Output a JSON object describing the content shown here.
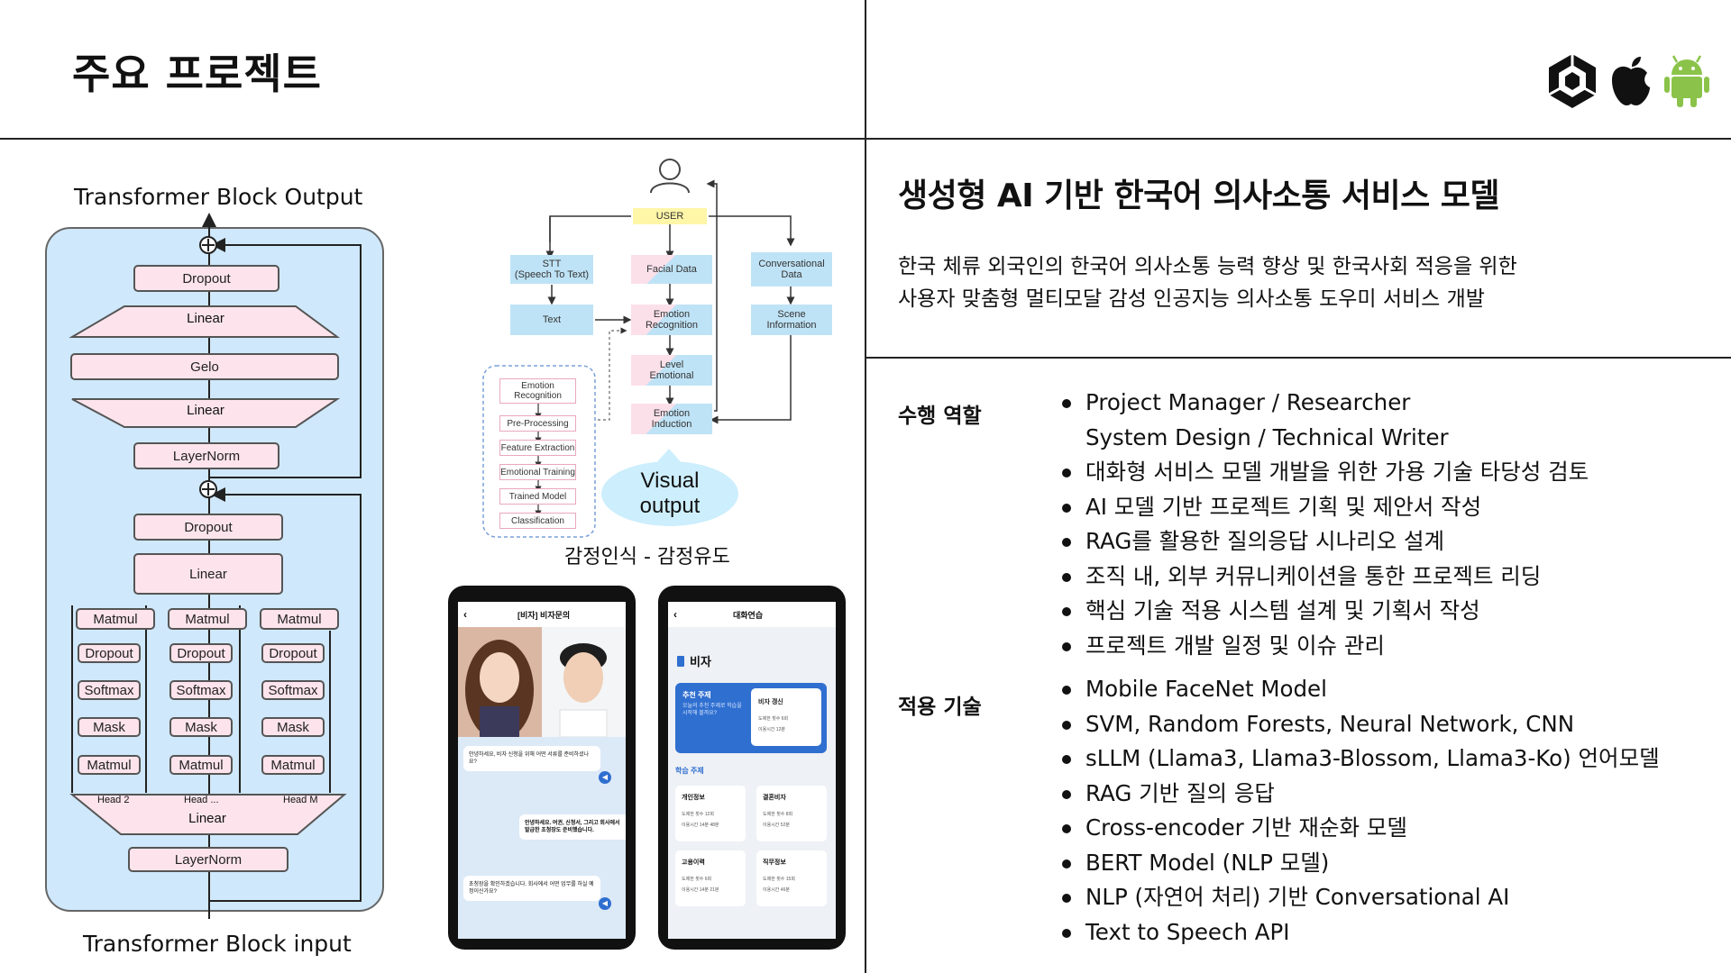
{
  "page": {
    "title": "주요 프로젝트"
  },
  "platform_icons": [
    "unity-icon",
    "apple-icon",
    "android-icon"
  ],
  "project": {
    "title": "생성형 AI 기반 한국어 의사소통 서비스 모델",
    "description": [
      "한국 체류 외국인의 한국어 의사소통 능력 향상 및 한국사회 적응을 위한",
      "사용자 맞춤형 멀티모달 감성 인공지능 의사소통 도우미 서비스 개발"
    ]
  },
  "roles": {
    "label": "수행 역할",
    "items": [
      "Project Manager / Researcher",
      "System Design / Technical Writer",
      "대화형 서비스 모델 개발을 위한 가용 기술 타당성 검토",
      "AI 모델 기반 프로젝트 기획 및 제안서 작성",
      "RAG를 활용한 질의응답 시나리오 설계",
      "조직 내, 외부 커뮤니케이션을 통한 프로젝트 리딩",
      "핵심 기술 적용 시스템 설계 및 기획서 작성",
      "프로젝트 개발 일정 및 이슈 관리"
    ]
  },
  "tech": {
    "label": "적용 기술",
    "items": [
      "Mobile FaceNet Model",
      "SVM, Random Forests, Neural Network, CNN",
      "sLLM (Llama3, Llama3-Blossom, Llama3-Ko) 언어모델",
      "RAG 기반 질의 응답",
      "Cross-encoder 기반 재순화 모델",
      "BERT Model (NLP 모델)",
      "NLP (자연어 처리) 기반 Conversational AI",
      "Text to Speech API"
    ]
  },
  "transformer": {
    "output_label": "Transformer Block Output",
    "input_label": "Transformer Block input",
    "upper": [
      "Dropout",
      "Linear",
      "Gelo",
      "Linear",
      "LayerNorm"
    ],
    "lower": [
      "Dropout",
      "Linear"
    ],
    "head_layers": [
      "Matmul",
      "Dropout",
      "Softmax",
      "Mask",
      "Matmul"
    ],
    "heads": [
      "Head 2",
      "Head ...",
      "Head M"
    ],
    "bottom_linear": "Linear",
    "bottom_norm": "LayerNorm"
  },
  "flow": {
    "user": "USER",
    "stt": "STT\n(Speech To Text)",
    "facial": "Facial Data",
    "conv": "Conversational\nData",
    "text": "Text",
    "emotion_recog": "Emotion\nRecognition",
    "scene": "Scene\nInformation",
    "level": "Level\nEmotional",
    "induction": "Emotion\nInduction",
    "visual": "Visual\noutput",
    "pipeline": [
      "Emotion\nRecognition",
      "Pre-Processing",
      "Feature Extraction",
      "Emotional Training",
      "Trained Model",
      "Classification"
    ],
    "caption": "감정인식 - 감정유도"
  },
  "phone1": {
    "header": "[비자] 비자문의",
    "msg1": "안녕하세요, 비자 신청을 위해 어떤 서류를 준비하셨나요?",
    "msg2": "안녕하세요. 여권, 신청서, 그리고 회사에서 발급한 초청장도 준비했습니다.",
    "msg3": "초청장을 확인하겠습니다. 회사에서 어떤 업무를 하실 예정이신가요?"
  },
  "phone2": {
    "header": "대화연습",
    "section": "비자",
    "card_title": "추천 주제",
    "card_text": "오늘의 추천 주제로 학습을 시작해 볼까요?",
    "card_item": "비자 갱신",
    "card_stat1": "도제한 횟수 6회",
    "card_stat2": "이용시간 12분",
    "study": "학습 주제",
    "topics": [
      {
        "name": "개인정보",
        "s1": "도제한 횟수 12회",
        "s2": "이용시간 14분 48분"
      },
      {
        "name": "결혼비자",
        "s1": "도제한 횟수 8회",
        "s2": "이용시간 52분"
      },
      {
        "name": "고용이력",
        "s1": "도제한 횟수 6회",
        "s2": "이용시간 14분 21분"
      },
      {
        "name": "직무정보",
        "s1": "도제한 횟수 15회",
        "s2": "이용시간 46분"
      }
    ]
  },
  "colors": {
    "diagram_bg": "#cfe8fb",
    "box_fill": "#fde4ec",
    "flow_box": "#bfe3f6",
    "user_box": "#fff6a8",
    "visual_bubble": "#cdeefc",
    "app_blue": "#2f6fd0",
    "android_green": "#8bc34a"
  }
}
